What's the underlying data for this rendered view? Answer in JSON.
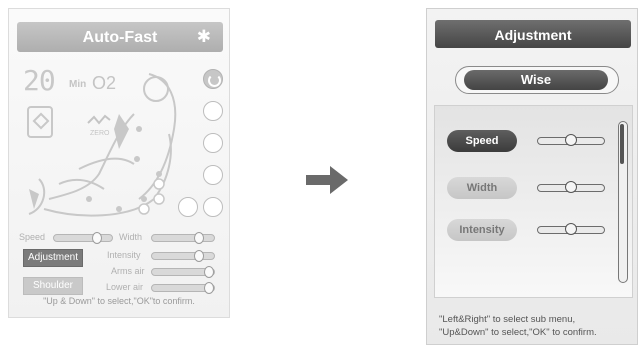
{
  "left_panel": {
    "title": "Auto-Fast",
    "bluetooth_icon": "bluetooth-icon",
    "timer_value": "20",
    "timer_unit": "Min",
    "oxygen_label": "O2",
    "zero_label": "ZERO",
    "controls": {
      "speed_label": "Speed",
      "width_label": "Width",
      "intensity_label": "Intensity",
      "arms_air_label": "Arms air",
      "lower_air_label": "Lower air",
      "adjustment_button": "Adjustment",
      "shoulder_button": "Shoulder"
    },
    "hint": "\"Up & Down\" to select,\"OK\"to confirm."
  },
  "arrow_icon": "right-arrow-icon",
  "right_panel": {
    "title": "Adjustment",
    "mode_label": "Wise",
    "items": [
      {
        "label": "Speed",
        "selected": true,
        "level": 0.5
      },
      {
        "label": "Width",
        "selected": false,
        "level": 0.5
      },
      {
        "label": "Intensity",
        "selected": false,
        "level": 0.5
      }
    ],
    "hint_line1": "\"Left&Right\" to select sub menu,",
    "hint_line2": "\"Up&Down\" to select,\"OK\" to confirm."
  },
  "colors": {
    "selected_bg": "#4a4a4a",
    "unselected_bg": "#cfcfcf",
    "left_title_bg": "#bbbbbb"
  }
}
